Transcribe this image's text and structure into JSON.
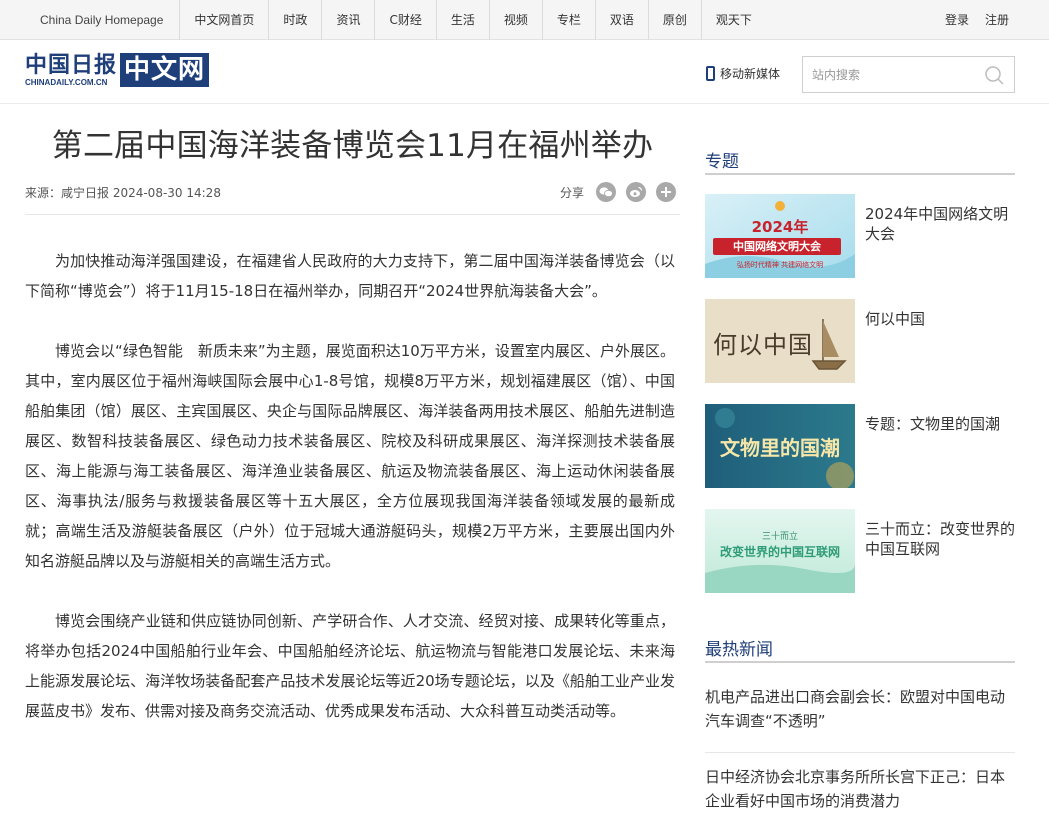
{
  "topnav": {
    "items": [
      "China Daily Homepage",
      "中文网首页",
      "时政",
      "资讯",
      "C财经",
      "生活",
      "视频",
      "专栏",
      "双语",
      "原创",
      "观天下"
    ],
    "login": "登录",
    "register": "注册"
  },
  "header": {
    "logo_cn": "中国日报",
    "logo_en": "CHINADAILY.COM.CN",
    "logo_zw": "中文网",
    "mobile": "移动新媒体",
    "search_placeholder": "站内搜索"
  },
  "article": {
    "title": "第二届中国海洋装备博览会11月在福州举办",
    "meta": "来源：咸宁日报   2024-08-30 14:28",
    "share_label": "分享",
    "paragraphs": [
      "为加快推动海洋强国建设，在福建省人民政府的大力支持下，第二届中国海洋装备博览会（以下简称“博览会”）将于11月15-18日在福州举办，同期召开“2024世界航海装备大会”。",
      "博览会以“绿色智能　新质未来”为主题，展览面积达10万平方米，设置室内展区、户外展区。其中，室内展区位于福州海峡国际会展中心1-8号馆，规模8万平方米，规划福建展区（馆）、中国船舶集团（馆）展区、主宾国展区、央企与国际品牌展区、海洋装备两用技术展区、船舶先进制造展区、数智科技装备展区、绿色动力技术装备展区、院校及科研成果展区、海洋探测技术装备展区、海上能源与海工装备展区、海洋渔业装备展区、航运及物流装备展区、海上运动休闲装备展区、海事执法/服务与救援装备展区等十五大展区，全方位展现我国海洋装备领域发展的最新成就；高端生活及游艇装备展区（户外）位于冠城大通游艇码头，规模2万平方米，主要展出国内外知名游艇品牌以及与游艇相关的高端生活方式。",
      "博览会围绕产业链和供应链协同创新、产学研合作、人才交流、经贸对接、成果转化等重点，将举办包括2024中国船舶行业年会、中国船舶经济论坛、航运物流与智能港口发展论坛、未来海上能源发展论坛、海洋牧场装备配套产品技术发展论坛等近20场专题论坛，以及《船舶工业产业发展蓝皮书》发布、供需对接及商务交流活动、优秀成果发布活动、大众科普互动类活动等。"
    ]
  },
  "sidebar": {
    "special_heading": "专题",
    "topics": [
      {
        "title": "2024年中国网络文明大会",
        "thumb_text": "2024年",
        "thumb_text2": "中国网络文明大会",
        "thumb_text3": "弘扬时代精神 共建网络文明"
      },
      {
        "title": "何以中国",
        "thumb_text": "何以中国"
      },
      {
        "title": "专题：文物里的国潮",
        "thumb_text": "文物里的国潮"
      },
      {
        "title": "三十而立：改变世界的中国互联网",
        "thumb_text": "三十而立",
        "thumb_text2": "改变世界的中国互联网"
      }
    ],
    "hot_heading": "最热新闻",
    "hot_news": [
      "机电产品进出口商会副会长：欧盟对中国电动汽车调查“不透明”",
      "日中经济协会北京事务所所长宫下正己：日本企业看好中国市场的消费潜力"
    ]
  },
  "colors": {
    "brand_blue": "#1f3f7a",
    "share_gray": "#a9a9a9"
  }
}
